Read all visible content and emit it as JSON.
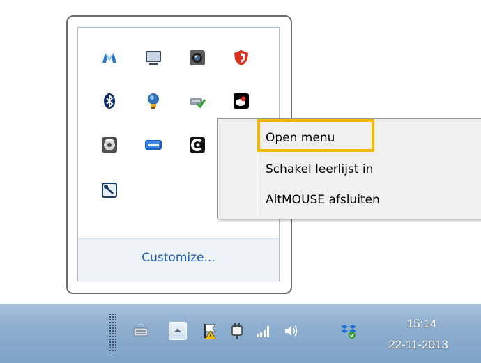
{
  "tray_popup": {
    "customize_label": "Customize...",
    "icons": [
      "malwarebytes-icon",
      "monitor-icon",
      "webcam-icon",
      "shield-security-icon",
      "bluetooth-icon",
      "lightbulb-icon",
      "usb-safely-remove-icon",
      "altmouse-icon",
      "disk-icon",
      "ccb-icon",
      "cc-app-icon",
      "tool-wrench-icon"
    ]
  },
  "context_menu": {
    "items": [
      "Open menu",
      "Schakel leerlijst in",
      "AltMOUSE afsluiten"
    ],
    "highlighted_item": "Open menu",
    "highlight_color": "#f5b800"
  },
  "taskbar": {
    "icons": [
      "keyboard-icon",
      "show-hidden-icons-icon",
      "action-center-flag-icon",
      "power-plug-icon",
      "network-signal-icon",
      "volume-icon",
      "dropbox-icon"
    ],
    "clock": {
      "time": "15:14",
      "date": "22-11-2013"
    }
  }
}
